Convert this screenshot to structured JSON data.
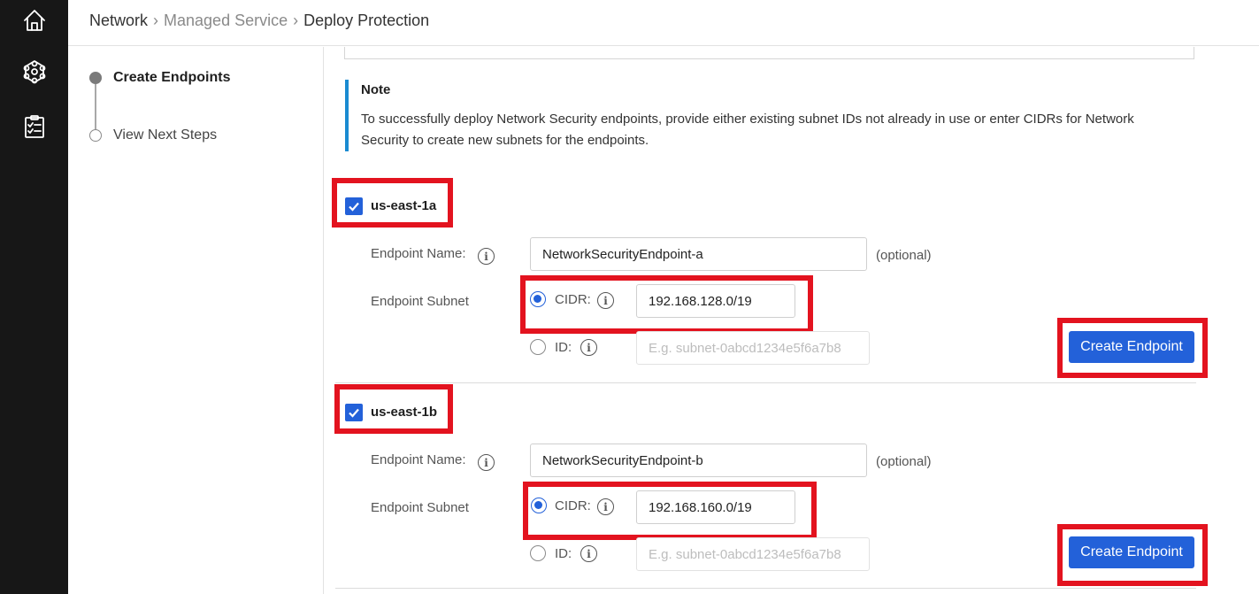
{
  "rail": {
    "icons": [
      "home-icon",
      "hexagon-cluster-icon",
      "clipboard-checklist-icon"
    ]
  },
  "breadcrumb": {
    "items": [
      "Network",
      "Managed Service",
      "Deploy Protection"
    ],
    "separator": "›"
  },
  "steps": [
    {
      "label": "Create Endpoints",
      "state": "active"
    },
    {
      "label": "View Next Steps",
      "state": "inactive"
    }
  ],
  "note": {
    "title": "Note",
    "body": "To successfully deploy Network Security endpoints, provide either existing subnet IDs not already in use or enter CIDRs for Network Security to create new subnets for the endpoints."
  },
  "zones": [
    {
      "name": "us-east-1a",
      "checked": true,
      "endpoint_name_label": "Endpoint Name:",
      "endpoint_name_value": "NetworkSecurityEndpoint-a",
      "optional_label": "(optional)",
      "subnet_label": "Endpoint Subnet",
      "cidr_label": "CIDR:",
      "cidr_value": "192.168.128.0/19",
      "id_label": "ID:",
      "id_placeholder": "E.g. subnet-0abcd1234e5f6a7b8",
      "selected_option": "CIDR",
      "button_label": "Create Endpoint"
    },
    {
      "name": "us-east-1b",
      "checked": true,
      "endpoint_name_label": "Endpoint Name:",
      "endpoint_name_value": "NetworkSecurityEndpoint-b",
      "optional_label": "(optional)",
      "subnet_label": "Endpoint Subnet",
      "cidr_label": "CIDR:",
      "cidr_value": "192.168.160.0/19",
      "id_label": "ID:",
      "id_placeholder": "E.g. subnet-0abcd1234e5f6a7b8",
      "selected_option": "CIDR",
      "button_label": "Create Endpoint"
    }
  ],
  "colors": {
    "accent": "#2361d9",
    "highlight": "#e3131f",
    "note_border": "#1a8bd1",
    "rail_bg": "#171717"
  }
}
